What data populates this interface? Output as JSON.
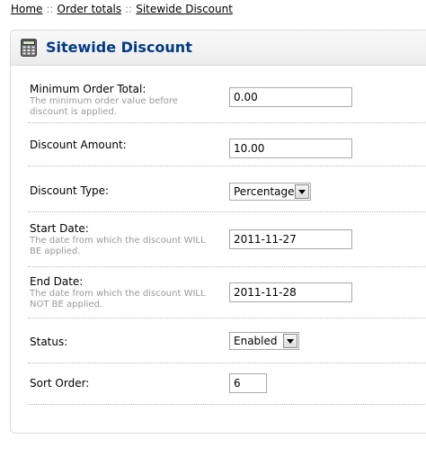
{
  "breadcrumb": {
    "items": [
      "Home",
      "Order totals",
      "Sitewide Discount"
    ],
    "separator": "::"
  },
  "heading": {
    "title": "Sitewide Discount",
    "icon": "calculator-icon"
  },
  "form": {
    "min_order_total": {
      "label": "Minimum Order Total:",
      "help": "The minimum order value before discount is applied.",
      "value": "0.00"
    },
    "discount_amount": {
      "label": "Discount Amount:",
      "value": "10.00"
    },
    "discount_type": {
      "label": "Discount Type:",
      "selected": "Percentage"
    },
    "start_date": {
      "label": "Start Date:",
      "help": "The date from which the discount WILL BE applied.",
      "value": "2011-11-27"
    },
    "end_date": {
      "label": "End Date:",
      "help": "The date from which the discount WILL NOT BE applied.",
      "value": "2011-11-28"
    },
    "status": {
      "label": "Status:",
      "selected": "Enabled"
    },
    "sort_order": {
      "label": "Sort Order:",
      "value": "6"
    }
  },
  "colors": {
    "heading_text": "#003a88",
    "help_text": "#999999",
    "border": "#dadada"
  }
}
